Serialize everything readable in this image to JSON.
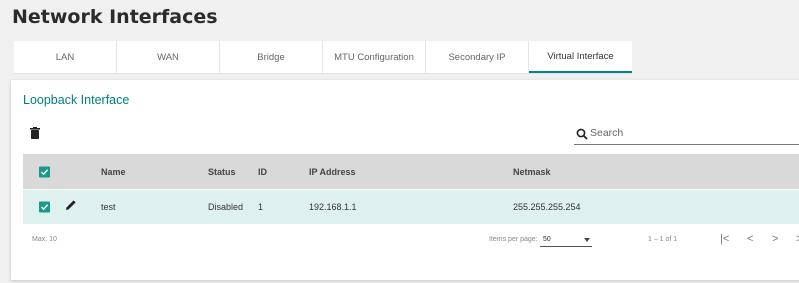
{
  "page": {
    "title": "Network Interfaces"
  },
  "tabs": [
    {
      "label": "LAN",
      "active": false
    },
    {
      "label": "WAN",
      "active": false
    },
    {
      "label": "Bridge",
      "active": false
    },
    {
      "label": "MTU Configuration",
      "active": false
    },
    {
      "label": "Secondary IP",
      "active": false
    },
    {
      "label": "Virtual Interface",
      "active": true
    }
  ],
  "card": {
    "title": "Loopback Interface",
    "toolbar": {
      "delete_icon": "trash-icon"
    },
    "search": {
      "placeholder": "Search",
      "icon": "search-icon"
    }
  },
  "table": {
    "columns": {
      "name": "Name",
      "status": "Status",
      "id": "ID",
      "ip": "IP Address",
      "netmask": "Netmask"
    },
    "rows": [
      {
        "selected": true,
        "name": "test",
        "status": "Disabled",
        "id": "1",
        "ip": "192.168.1.1",
        "netmask": "255.255.255.254"
      }
    ]
  },
  "footer": {
    "max_label": "Max. 10",
    "items_per_page_label": "Items per page:",
    "items_per_page": "50",
    "range_label": "1 – 1 of 1",
    "first_icon": "|<",
    "prev_icon": "<",
    "next_icon": ">",
    "last_icon": ">|"
  },
  "colors": {
    "accent": "#008787",
    "checkbox": "#1a9a8a",
    "header_row": "#d9d9d9",
    "selected_row": "#dff1ee"
  }
}
